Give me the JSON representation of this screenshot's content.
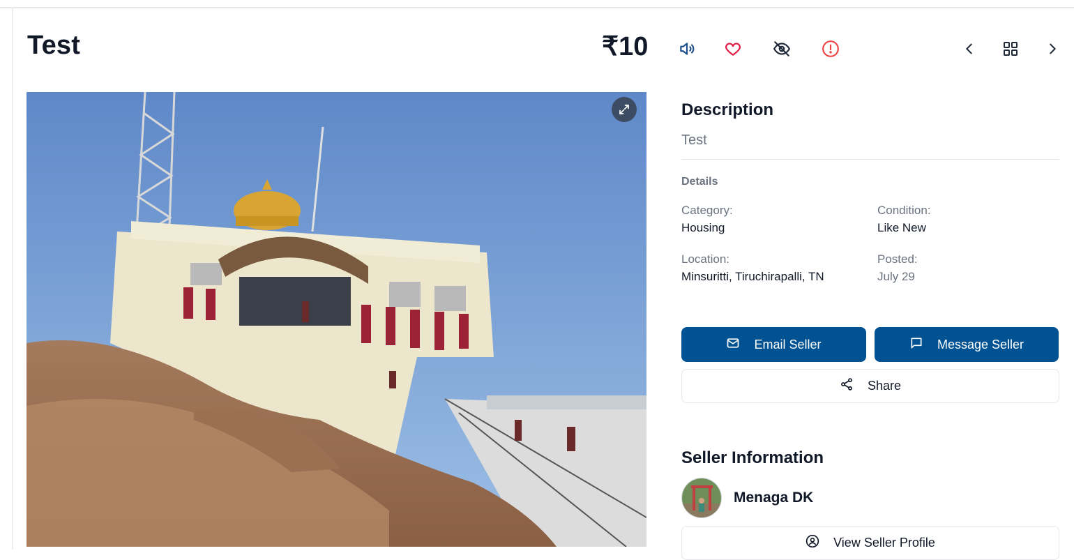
{
  "listing": {
    "title": "Test",
    "price": "₹10"
  },
  "actions": {
    "icons": [
      "speaker-icon",
      "heart-icon",
      "eye-off-icon",
      "alert-icon"
    ],
    "nav_icons": [
      "chevron-left-icon",
      "grid-icon",
      "chevron-right-icon"
    ]
  },
  "description": {
    "heading": "Description",
    "text": "Test"
  },
  "details": {
    "heading": "Details",
    "category_label": "Category:",
    "category_value": "Housing",
    "condition_label": "Condition:",
    "condition_value": "Like New",
    "location_label": "Location:",
    "location_value": "Minsuritti, Tiruchirapalli, TN",
    "posted_label": "Posted:",
    "posted_value": "July 29"
  },
  "buttons": {
    "email": "Email Seller",
    "message": "Message Seller",
    "share": "Share",
    "view_profile": "View Seller Profile"
  },
  "seller": {
    "heading": "Seller Information",
    "name": "Menaga DK"
  },
  "colors": {
    "primary": "#005293",
    "heart": "#e11d48",
    "alert": "#ef4444",
    "speaker": "#1d4e89"
  }
}
